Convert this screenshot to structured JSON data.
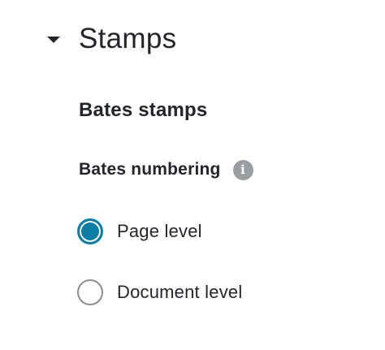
{
  "section": {
    "title": "Stamps",
    "expanded": true,
    "caret_icon": "caret-down-icon"
  },
  "bates": {
    "heading": "Bates stamps",
    "numbering_label": "Bates numbering",
    "info_icon": "info-icon",
    "info_glyph": "i",
    "options": [
      {
        "label": "Page level",
        "selected": true
      },
      {
        "label": "Document level",
        "selected": false
      }
    ]
  },
  "colors": {
    "accent": "#0b7ea5",
    "text": "#222529",
    "info_icon_bg": "#9a9ea3",
    "radio_border": "#8a8e93"
  }
}
